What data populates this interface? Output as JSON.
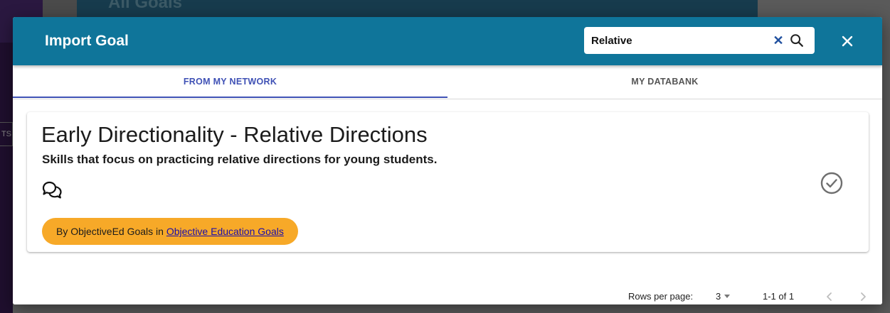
{
  "background": {
    "page_title": "All Goals",
    "side_chip": "TS"
  },
  "dialog": {
    "title": "Import Goal",
    "search": {
      "value": "Relative",
      "placeholder": ""
    },
    "icons": {
      "clear": "close-x-icon",
      "search": "magnifier-icon",
      "close": "close-x-icon"
    }
  },
  "tabs": [
    {
      "label": "FROM MY NETWORK",
      "active": true
    },
    {
      "label": "MY DATABANK",
      "active": false
    }
  ],
  "goals": [
    {
      "title": "Early Directionality - Relative Directions",
      "description": "Skills that focus on practicing relative directions for young students.",
      "author_prefix": "By ObjectiveEd Goals in ",
      "author_link": "Objective Education Goals",
      "icons": [
        "comments-icon",
        "check-circle-icon"
      ]
    }
  ],
  "pagination": {
    "rows_label": "Rows per page:",
    "rows_per_page": "3",
    "range": "1-1 of 1"
  },
  "colors": {
    "header": "#0f759a",
    "tab_active": "#3f51b5",
    "chip": "#f7a928",
    "link": "#1a0dab"
  }
}
